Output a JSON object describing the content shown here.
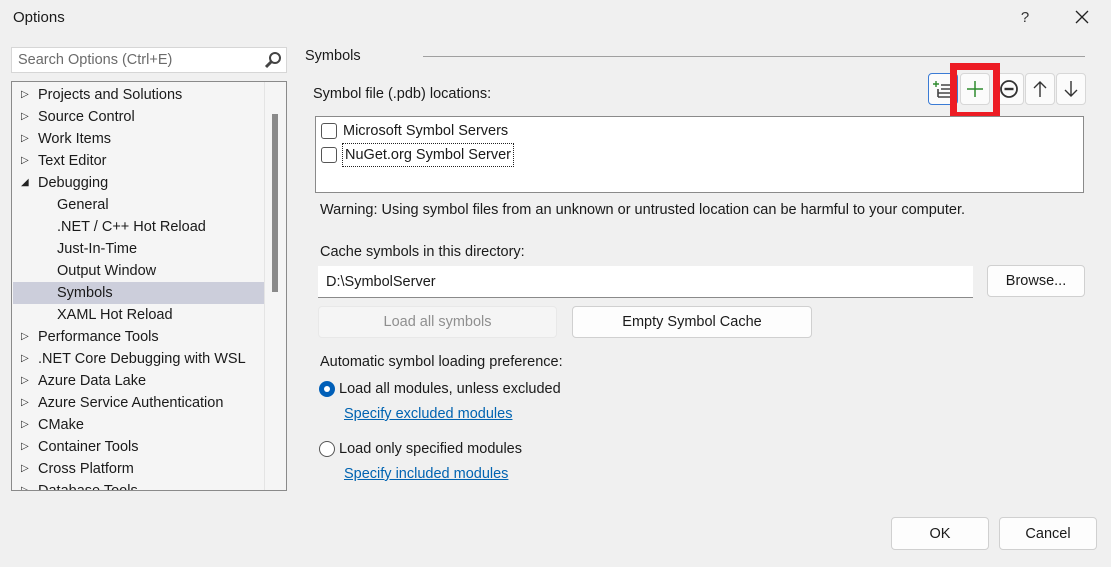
{
  "window": {
    "title": "Options",
    "help_label": "?",
    "close_icon": "close-icon"
  },
  "search": {
    "placeholder": "Search Options (Ctrl+E)",
    "value": "",
    "icon": "search-icon"
  },
  "tree": {
    "items": [
      {
        "label": "Projects and Solutions",
        "level": 0,
        "expander": "collapsed"
      },
      {
        "label": "Source Control",
        "level": 0,
        "expander": "collapsed"
      },
      {
        "label": "Work Items",
        "level": 0,
        "expander": "collapsed"
      },
      {
        "label": "Text Editor",
        "level": 0,
        "expander": "collapsed"
      },
      {
        "label": "Debugging",
        "level": 0,
        "expander": "expanded"
      },
      {
        "label": "General",
        "level": 1
      },
      {
        "label": ".NET / C++ Hot Reload",
        "level": 1
      },
      {
        "label": "Just-In-Time",
        "level": 1
      },
      {
        "label": "Output Window",
        "level": 1
      },
      {
        "label": "Symbols",
        "level": 1,
        "selected": true
      },
      {
        "label": "XAML Hot Reload",
        "level": 1
      },
      {
        "label": "Performance Tools",
        "level": 0,
        "expander": "collapsed"
      },
      {
        "label": ".NET Core Debugging with WSL",
        "level": 0,
        "expander": "collapsed"
      },
      {
        "label": "Azure Data Lake",
        "level": 0,
        "expander": "collapsed"
      },
      {
        "label": "Azure Service Authentication",
        "level": 0,
        "expander": "collapsed"
      },
      {
        "label": "CMake",
        "level": 0,
        "expander": "collapsed"
      },
      {
        "label": "Container Tools",
        "level": 0,
        "expander": "collapsed"
      },
      {
        "label": "Cross Platform",
        "level": 0,
        "expander": "collapsed"
      },
      {
        "label": "Database Tools",
        "level": 0,
        "expander": "collapsed"
      }
    ]
  },
  "panel": {
    "section_title": "Symbols",
    "pdb_label": "Symbol file (.pdb) locations:",
    "toolbar": {
      "load_all_icon": "load-list-icon",
      "add_icon": "add-icon",
      "remove_icon": "remove-icon",
      "move_up_icon": "arrow-up-icon",
      "move_down_icon": "arrow-down-icon",
      "highlight_color": "#ed1c24"
    },
    "locations": [
      {
        "label": "Microsoft Symbol Servers",
        "checked": false
      },
      {
        "label": "NuGet.org Symbol Server",
        "checked": false,
        "focused": true
      }
    ],
    "warning": "Warning: Using symbol files from an unknown or untrusted location can be harmful to your computer.",
    "cache_label": "Cache symbols in this directory:",
    "cache_value": "D:\\SymbolServer",
    "browse_label": "Browse...",
    "load_all_label": "Load all symbols",
    "empty_cache_label": "Empty Symbol Cache",
    "auto_label": "Automatic symbol loading preference:",
    "radio_all": {
      "label": "Load all modules, unless excluded",
      "selected": true
    },
    "link_excluded": "Specify excluded modules",
    "radio_specified": {
      "label": "Load only specified modules",
      "selected": false
    },
    "link_included": "Specify included modules"
  },
  "footer": {
    "ok_label": "OK",
    "cancel_label": "Cancel"
  },
  "colors": {
    "accent": "#005fb8",
    "link": "#0063b1",
    "selection": "#cccedb",
    "add_green": "#2e8b2e"
  }
}
